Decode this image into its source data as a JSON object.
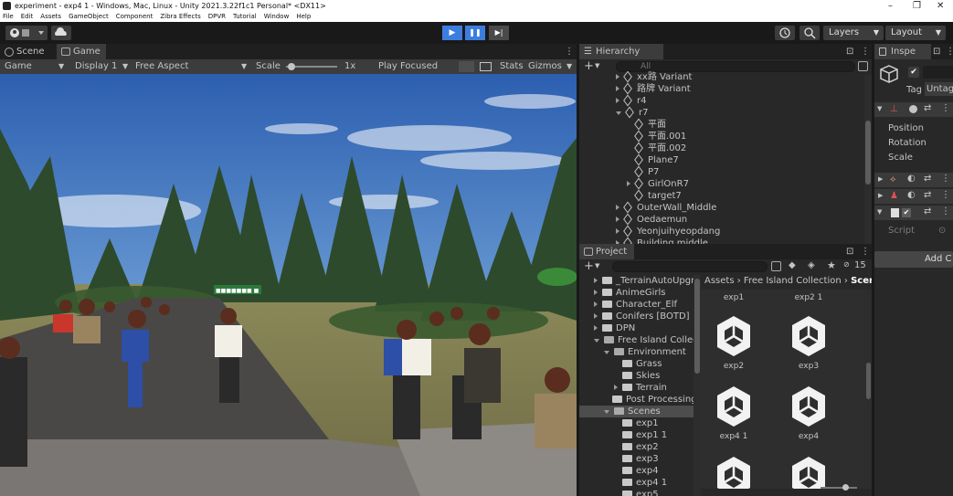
{
  "window": {
    "title": "experiment - exp4 1 - Windows, Mac, Linux - Unity 2021.3.22f1c1 Personal* <DX11>",
    "controls": [
      "–",
      "❐",
      "✕"
    ]
  },
  "menu": [
    "File",
    "Edit",
    "Assets",
    "GameObject",
    "Component",
    "Zibra Effects",
    "DPVR",
    "Tutorial",
    "Window",
    "Help"
  ],
  "toolbar": {
    "account_icon": "account-icon",
    "cloud_icon": "cloud-icon",
    "play": "▶",
    "pause": "❚❚",
    "step": "▶|",
    "layers": "Layers",
    "layout": "Layout"
  },
  "scene_tabs": {
    "scene": "Scene",
    "game": "Game"
  },
  "game_bar": {
    "display_mode": "Game",
    "display": "Display 1",
    "aspect": "Free Aspect",
    "scale_label": "Scale",
    "scale_value": "1x",
    "play_focused": "Play Focused",
    "stats": "Stats",
    "gizmos": "Gizmos",
    "scale_fraction": 0.05
  },
  "game_view": {
    "sign_text": "■■■■■■■ ■"
  },
  "hierarchy": {
    "title": "Hierarchy",
    "search_placeholder": "All",
    "items": [
      {
        "label": "xx路 Variant",
        "depth": 1,
        "arrow": "right"
      },
      {
        "label": "路牌 Variant",
        "depth": 1,
        "arrow": "right"
      },
      {
        "label": "r4",
        "depth": 1,
        "arrow": "right"
      },
      {
        "label": "r7",
        "depth": 1,
        "arrow": "down"
      },
      {
        "label": "平面",
        "depth": 2,
        "arrow": ""
      },
      {
        "label": "平面.001",
        "depth": 2,
        "arrow": ""
      },
      {
        "label": "平面.002",
        "depth": 2,
        "arrow": ""
      },
      {
        "label": "Plane7",
        "depth": 2,
        "arrow": ""
      },
      {
        "label": "P7",
        "depth": 2,
        "arrow": ""
      },
      {
        "label": "GirlOnR7",
        "depth": 2,
        "arrow": "right"
      },
      {
        "label": "target7",
        "depth": 2,
        "arrow": ""
      },
      {
        "label": "OuterWall_Middle",
        "depth": 1,
        "arrow": "right"
      },
      {
        "label": "Oedaemun",
        "depth": 1,
        "arrow": "right"
      },
      {
        "label": "Yeonjuihyeopdang",
        "depth": 1,
        "arrow": "right"
      },
      {
        "label": "Building middle",
        "depth": 1,
        "arrow": "right"
      }
    ]
  },
  "project": {
    "title": "Project",
    "hidden_count": "15",
    "breadcrumb": [
      "Assets",
      "Free Island Collection",
      "Scen"
    ],
    "folders": [
      {
        "label": "_TerrainAutoUpgr",
        "depth": 1,
        "arrow": "right"
      },
      {
        "label": "AnimeGirls",
        "depth": 1,
        "arrow": "right"
      },
      {
        "label": "Character_Elf",
        "depth": 1,
        "arrow": "right"
      },
      {
        "label": "Conifers [BOTD]",
        "depth": 1,
        "arrow": "right"
      },
      {
        "label": "DPN",
        "depth": 1,
        "arrow": "right"
      },
      {
        "label": "Free Island Collec",
        "depth": 1,
        "arrow": "down"
      },
      {
        "label": "Environment",
        "depth": 2,
        "arrow": "down"
      },
      {
        "label": "Grass",
        "depth": 3,
        "arrow": ""
      },
      {
        "label": "Skies",
        "depth": 3,
        "arrow": ""
      },
      {
        "label": "Terrain",
        "depth": 3,
        "arrow": "right"
      },
      {
        "label": "Post Processing",
        "depth": 2,
        "arrow": ""
      },
      {
        "label": "Scenes",
        "depth": 2,
        "arrow": "down",
        "selected": true
      },
      {
        "label": "exp1",
        "depth": 3,
        "arrow": ""
      },
      {
        "label": "exp1 1",
        "depth": 3,
        "arrow": ""
      },
      {
        "label": "exp2",
        "depth": 3,
        "arrow": ""
      },
      {
        "label": "exp3",
        "depth": 3,
        "arrow": ""
      },
      {
        "label": "exp4",
        "depth": 3,
        "arrow": ""
      },
      {
        "label": "exp4 1",
        "depth": 3,
        "arrow": ""
      },
      {
        "label": "exp5",
        "depth": 3,
        "arrow": ""
      }
    ],
    "grid_top_labels": [
      "exp1",
      "exp2 1"
    ],
    "grid": [
      "exp2",
      "exp3",
      "exp4 1",
      "exp4",
      "",
      ""
    ]
  },
  "inspector": {
    "title": "Inspe",
    "tag_label": "Tag",
    "tag_value": "Untag",
    "transform_fields": [
      "Position",
      "Rotation",
      "Scale"
    ],
    "script_label": "Script",
    "add_component": "Add C"
  }
}
